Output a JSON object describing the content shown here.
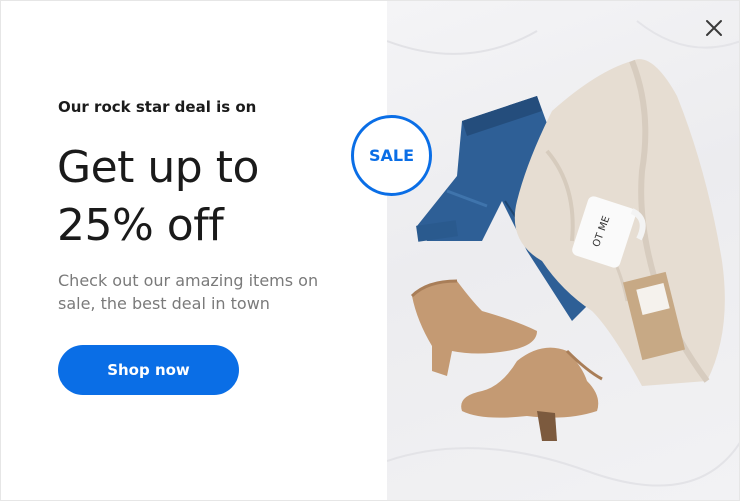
{
  "popup": {
    "kicker": "Our rock star deal is on",
    "headline_line1": "Get up to",
    "headline_line2": "25% off",
    "subtext": "Check out our amazing items on sale, the best deal in town",
    "cta_label": "Shop now",
    "badge_label": "SALE",
    "close_icon": "close-icon",
    "mug_text": "OT ME"
  },
  "colors": {
    "accent": "#0a6ee6",
    "text_dark": "#1a1a1a",
    "text_muted": "#7a7a7a",
    "photo_background": "#f0f0f2"
  }
}
